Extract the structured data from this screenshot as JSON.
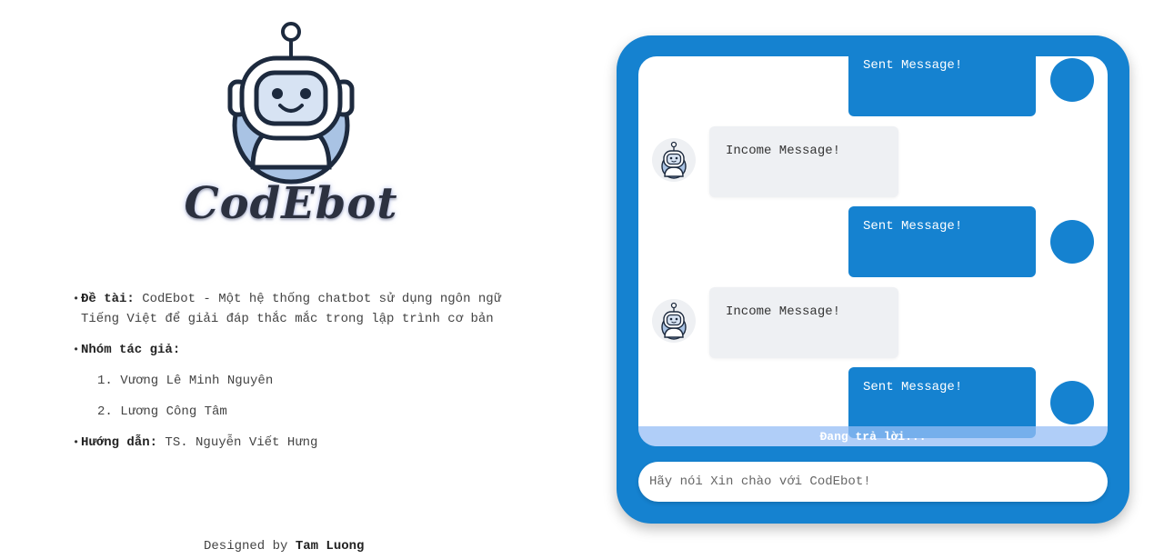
{
  "brand": {
    "name": "CodEbot"
  },
  "info": {
    "topic_label": "Đề tài:",
    "topic_text": "CodEbot - Một hệ thống chatbot sử dụng ngôn ngữ Tiếng Việt để giải đáp thắc mắc trong lập trình cơ bản",
    "authors_label": "Nhóm tác giả:",
    "authors": [
      "1. Vương Lê Minh Nguyên",
      "2. Lương Công Tâm"
    ],
    "advisor_label": "Hướng dẫn:",
    "advisor_text": "TS. Nguyễn Viết Hưng"
  },
  "footer": {
    "prefix": "Designed by",
    "author": "Tam Luong"
  },
  "chat": {
    "messages": [
      {
        "dir": "out",
        "text": "Sent Message!"
      },
      {
        "dir": "in",
        "text": "Income Message!"
      },
      {
        "dir": "out",
        "text": "Sent Message!"
      },
      {
        "dir": "in",
        "text": "Income Message!"
      },
      {
        "dir": "out",
        "text": "Sent Message!"
      }
    ],
    "typing_status": "Đang trả lời...",
    "input_placeholder": "Hãy nói Xin chào với CodEbot!",
    "colors": {
      "primary": "#1582d0",
      "incoming_bg": "#eef0f3",
      "typing_bar": "#96bef5"
    }
  },
  "icons": {
    "logo": "robot-logo-icon",
    "bot_avatar": "robot-avatar-icon",
    "user_avatar": "user-avatar-icon"
  }
}
